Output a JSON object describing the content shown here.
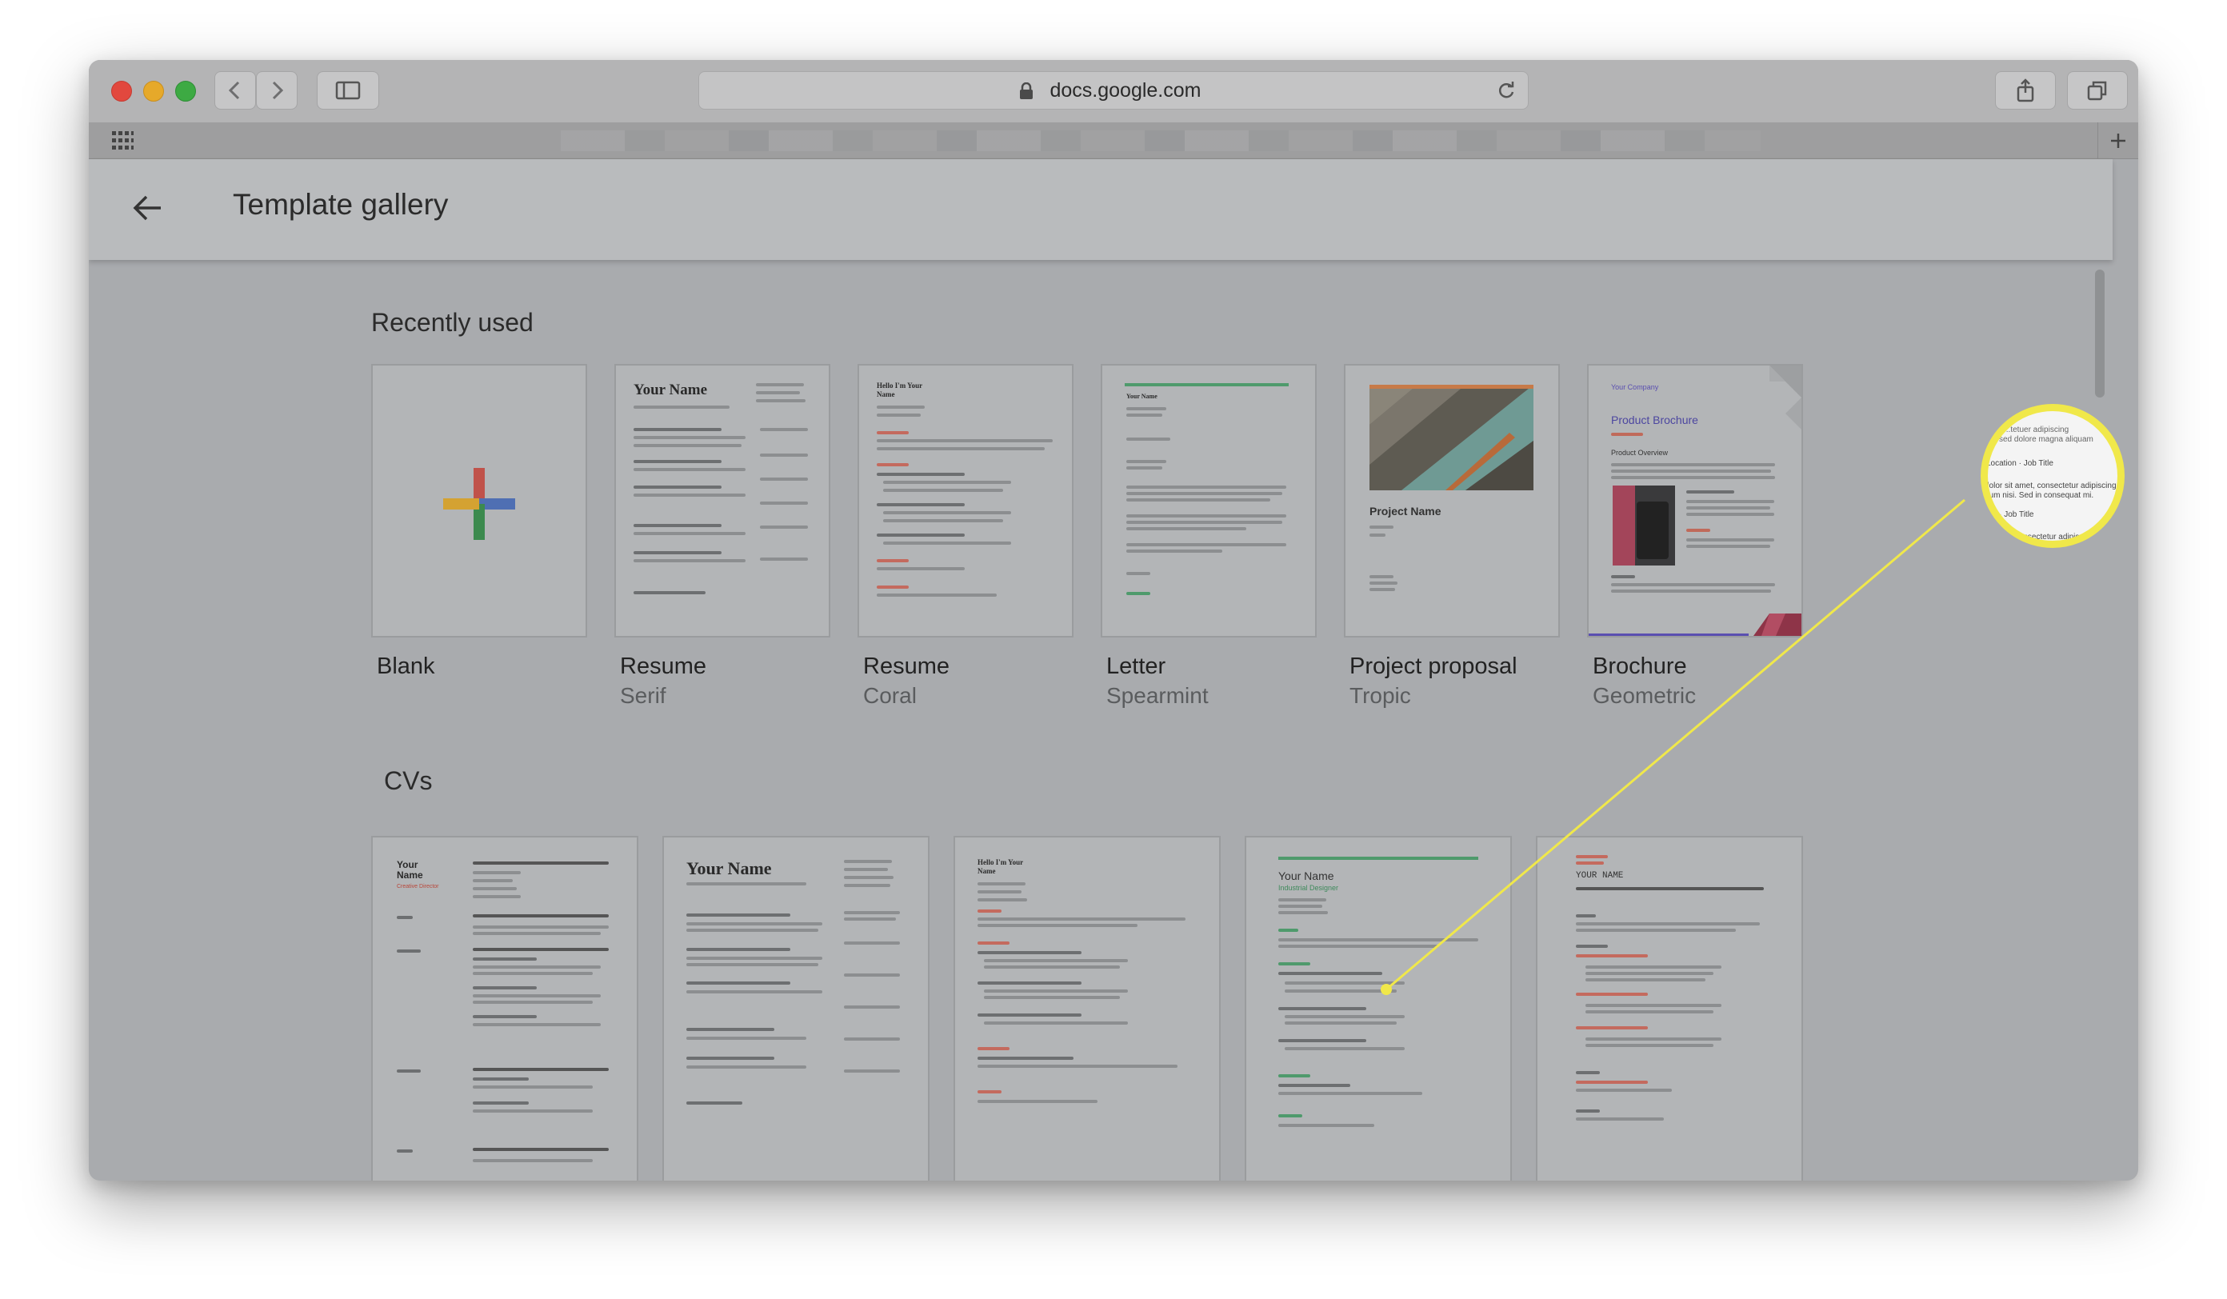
{
  "browser": {
    "url": "docs.google.com"
  },
  "header": {
    "title": "Template gallery"
  },
  "recently_used": {
    "title": "Recently used",
    "cards": [
      {
        "title": "Blank",
        "subtitle": ""
      },
      {
        "title": "Resume",
        "subtitle": "Serif",
        "preview_heading": "Your Name"
      },
      {
        "title": "Resume",
        "subtitle": "Coral",
        "preview_heading": "Hello I'm Your Name"
      },
      {
        "title": "Letter",
        "subtitle": "Spearmint",
        "preview_heading": "Your Name"
      },
      {
        "title": "Project proposal",
        "subtitle": "Tropic",
        "preview_heading": "Project Name"
      },
      {
        "title": "Brochure",
        "subtitle": "Geometric",
        "preview_heading": "Product Brochure",
        "preview_company": "Your Company",
        "preview_section": "Product Overview"
      }
    ]
  },
  "cvs": {
    "title": "CVs",
    "cards": [
      {
        "preview_heading": "Your Name",
        "preview_role": "Creative Director"
      },
      {
        "preview_heading": "Your Name"
      },
      {
        "preview_heading": "Hello I'm Your Name"
      },
      {
        "preview_heading": "Your Name",
        "preview_role": "Industrial Designer"
      },
      {
        "preview_heading": "YOUR NAME"
      }
    ]
  },
  "magnifier": {
    "lines": [
      "Location · Job Title",
      "dolor sit amet, consectetur adipiscing elit.",
      "dum nisi. Sed in consequat mi.",
      "ion · Job Title",
      "amet, consectetur adipiscing"
    ]
  },
  "colors": {
    "highlight": "#f0e84a",
    "coral": "#d9604d",
    "spearmint": "#3f9a6a",
    "brochure_accent": "#5a4fb0"
  }
}
